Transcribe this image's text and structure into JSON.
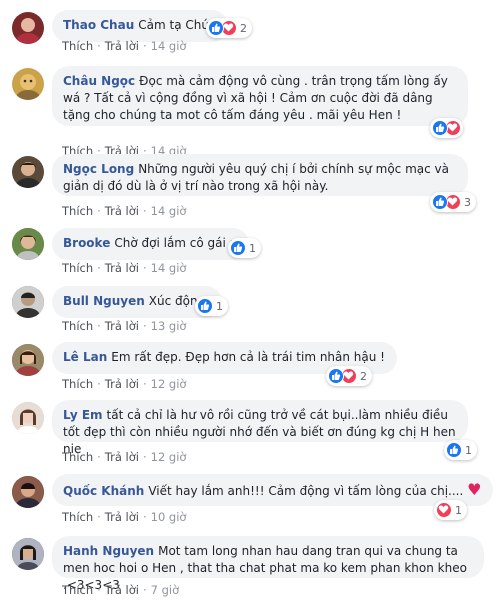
{
  "actions": {
    "like": "Thích",
    "reply": "Trả lời"
  },
  "comments": [
    {
      "name": "Thao Chau",
      "text": "Cảm tạ Chúa",
      "time": "14 giờ",
      "reactions": [
        "like",
        "love"
      ],
      "count": "2",
      "avatar_color": "#7a2a2a"
    },
    {
      "name": "Châu Ngọc",
      "text": "Đọc mà cảm động vô cùng . trân trọng tấm lòng ấy wá ? Tất cả vì cộng đồng vì xã hội ! Cảm ơn cuộc đời đã dâng tặng cho chúng ta mot cô tấm đáng yêu . mãi yêu Hen !",
      "time": "14 giờ",
      "reactions": [
        "like",
        "love"
      ],
      "count": "",
      "avatar_color": "#c9a24a"
    },
    {
      "name": "Ngọc Long",
      "text": "Những người yêu quý chị í bởi chính sự mộc mạc và giản dị đó dù là ở vị trí nào trong xã hội này.",
      "time": "14 giờ",
      "reactions": [
        "like",
        "love"
      ],
      "count": "3",
      "avatar_color": "#5a4a3a"
    },
    {
      "name": "Brooke",
      "text": "Chờ đợi lắm cô gái ạ",
      "time": "14 giờ",
      "reactions": [
        "like"
      ],
      "count": "1",
      "avatar_color": "#5b7a3a"
    },
    {
      "name": "Bull Nguyen",
      "text": "Xúc động!",
      "time": "13 giờ",
      "reactions": [
        "like"
      ],
      "count": "1",
      "avatar_color": "#444444"
    },
    {
      "name": "Lê Lan",
      "text": "Em rất đẹp. Đẹp hơn cả là trái tim nhân hậu !",
      "time": "12 giờ",
      "reactions": [
        "like",
        "love"
      ],
      "count": "2",
      "avatar_color": "#7a5a3a"
    },
    {
      "name": "Ly Em",
      "text": "tất cả chỉ là hư vô rồi cũng trở về cát bụi..làm nhiều điều tốt đẹp thì còn nhiều người nhớ đến và biết ơn đúng kg chị H hen nie",
      "time": "12 giờ",
      "reactions": [
        "like"
      ],
      "count": "1",
      "avatar_color": "#c8b6a6"
    },
    {
      "name": "Quốc Khánh",
      "text": "Viết hay lắm anh!!! Cảm động vì tấm lòng của chị.... ",
      "time": "10 giờ",
      "reactions": [
        "love"
      ],
      "count": "1",
      "avatar_color": "#6a3a3a"
    },
    {
      "name": "Hanh Nguyen",
      "text": "Mot tam long nhan hau dang tran qui va chung ta men hoc hoi o Hen , that tha chat phat ma ko kem phan khon kheo .<3<3<3",
      "time": "7 giờ",
      "reactions": [],
      "count": "",
      "avatar_color": "#3a3a4a"
    }
  ]
}
